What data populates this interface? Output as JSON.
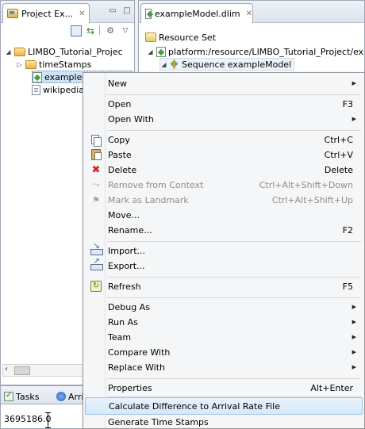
{
  "project_explorer": {
    "tab_title": "Project Ex...",
    "tree": [
      {
        "label": "LIMBO_Tutorial_Projec",
        "icon": "project-folder-icon",
        "expanded": true
      },
      {
        "label": "timeStamps",
        "icon": "folder-icon",
        "expanded": false
      },
      {
        "label": "exampleModel.dlim",
        "icon": "model-file-icon"
      },
      {
        "label": "wikipedia",
        "icon": "text-file-icon"
      }
    ]
  },
  "bottom_panel": {
    "tasks_tab": "Tasks",
    "arrival_tab": "Arrival",
    "console_value": "3695186.0"
  },
  "editor": {
    "tab_title": "exampleModel.dlim",
    "tree": [
      {
        "label": "Resource Set"
      },
      {
        "label": "platform:/resource/LIMBO_Tutorial_Project/exampleModel.dlim"
      },
      {
        "label": "Sequence exampleModel"
      }
    ]
  },
  "context_menu": {
    "groups": [
      [
        {
          "label": "New",
          "submenu": true
        }
      ],
      [
        {
          "label": "Open",
          "accel": "F3"
        },
        {
          "label": "Open With",
          "submenu": true
        }
      ],
      [
        {
          "label": "Copy",
          "accel": "Ctrl+C",
          "icon": "copy-icon"
        },
        {
          "label": "Paste",
          "accel": "Ctrl+V",
          "icon": "paste-icon"
        },
        {
          "label": "Delete",
          "accel": "Delete",
          "icon": "delete-icon"
        },
        {
          "label": "Remove from Context",
          "accel": "Ctrl+Alt+Shift+Down",
          "icon": "remove-context-icon",
          "disabled": true
        },
        {
          "label": "Mark as Landmark",
          "accel": "Ctrl+Alt+Shift+Up",
          "icon": "landmark-icon",
          "disabled": true
        },
        {
          "label": "Move..."
        },
        {
          "label": "Rename...",
          "accel": "F2"
        }
      ],
      [
        {
          "label": "Import...",
          "icon": "import-icon"
        },
        {
          "label": "Export...",
          "icon": "export-icon"
        }
      ],
      [
        {
          "label": "Refresh",
          "accel": "F5",
          "icon": "refresh-icon"
        }
      ],
      [
        {
          "label": "Debug As",
          "submenu": true
        },
        {
          "label": "Run As",
          "submenu": true
        },
        {
          "label": "Team",
          "submenu": true
        },
        {
          "label": "Compare With",
          "submenu": true
        },
        {
          "label": "Replace With",
          "submenu": true
        }
      ],
      [
        {
          "label": "Properties",
          "accel": "Alt+Enter"
        }
      ],
      [
        {
          "label": "Calculate Difference to Arrival Rate File",
          "highlighted": true
        },
        {
          "label": "Generate Time Stamps"
        }
      ]
    ]
  },
  "colors": {
    "menu_bg": "#f5f6f7",
    "highlight": "#d6e8f9",
    "delete_red": "#d42020",
    "disabled_text": "#8d8d8d"
  }
}
